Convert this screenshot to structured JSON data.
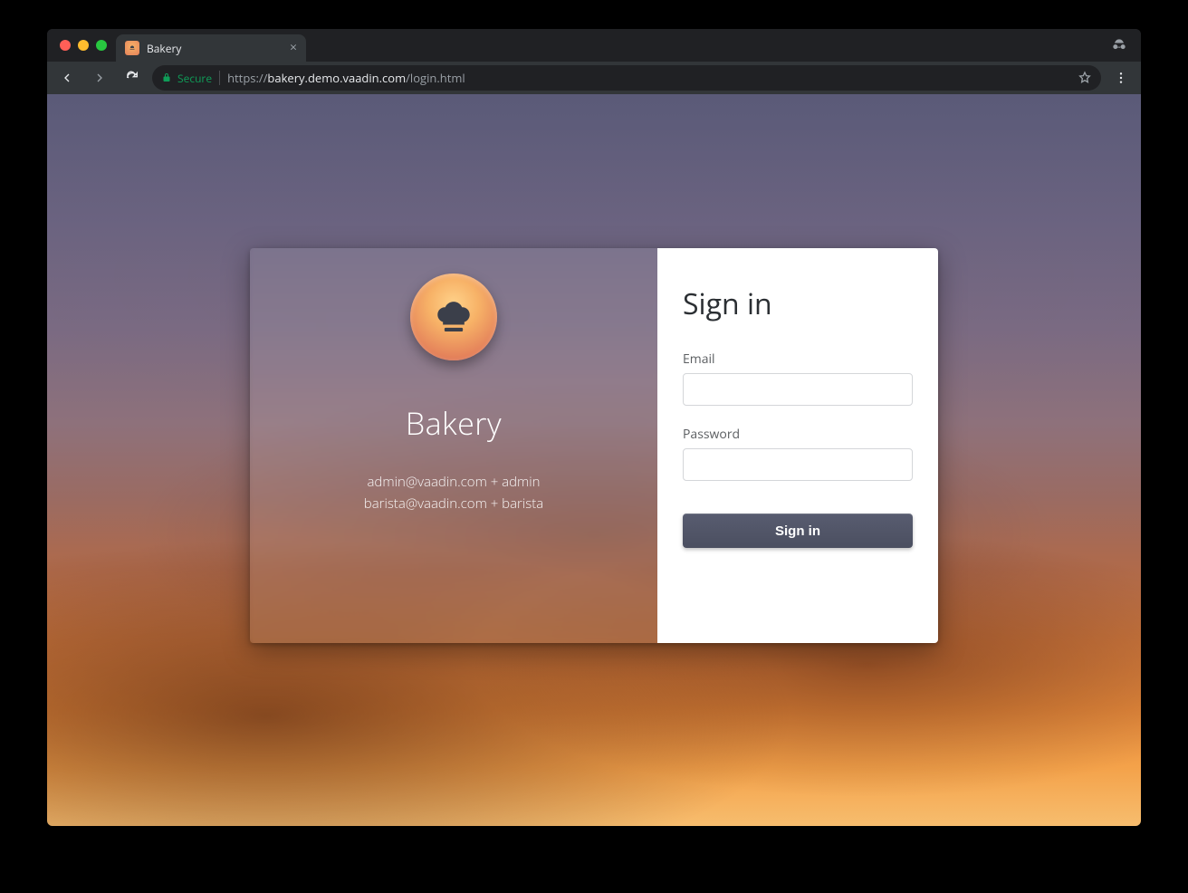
{
  "browser": {
    "tab_title": "Bakery",
    "secure_label": "Secure",
    "url_scheme": "https://",
    "url_host": "bakery.demo.vaadin.com",
    "url_path": "/login.html"
  },
  "left": {
    "app_name": "Bakery",
    "hint_line1": "admin@vaadin.com + admin",
    "hint_line2": "barista@vaadin.com + barista"
  },
  "form": {
    "title": "Sign in",
    "email_label": "Email",
    "email_value": "",
    "password_label": "Password",
    "password_value": "",
    "submit_label": "Sign in"
  },
  "colors": {
    "button_bg": "#4f5366",
    "logo_gradient_top": "#ffd28a",
    "logo_gradient_bottom": "#c96a69"
  }
}
